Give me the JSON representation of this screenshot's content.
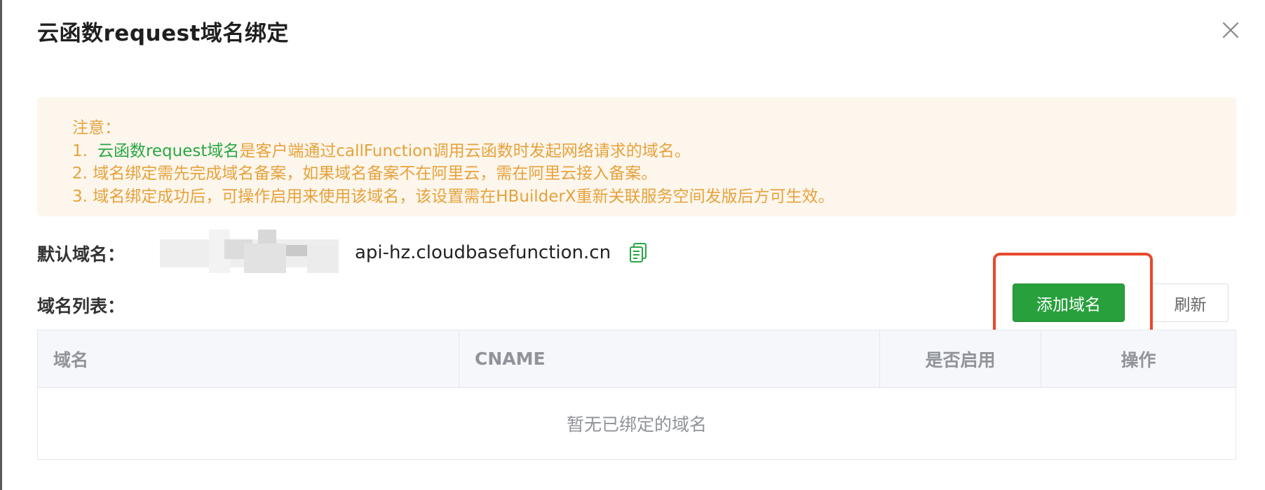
{
  "dialog": {
    "title": "云函数request域名绑定",
    "close_icon": "close-icon"
  },
  "notice": {
    "heading": "注意：",
    "line1_number": "1.",
    "line1_highlight": "云函数request域名",
    "line1_rest": "是客户端通过callFunction调用云函数时发起网络请求的域名。",
    "line2": "2. 域名绑定需先完成域名备案，如果域名备案不在阿里云，需在阿里云接入备案。",
    "line3": "3. 域名绑定成功后，可操作启用来使用该域名，该设置需在HBuilderX重新关联服务空间发版后方可生效。"
  },
  "default_domain": {
    "label": "默认域名：",
    "value_suffix": "api-hz.cloudbasefunction.cn",
    "copy_icon": "copy-icon"
  },
  "domain_list": {
    "label": "域名列表：",
    "add_button": "添加域名",
    "refresh_button": "刷新"
  },
  "table": {
    "columns": [
      "域名",
      "CNAME",
      "是否启用",
      "操作"
    ],
    "empty_text": "暂无已绑定的域名"
  },
  "colors": {
    "warning_text": "#e6a23c",
    "highlight_green": "#28a745",
    "primary_button": "#28a03c",
    "annotation_red": "#e8492c"
  }
}
